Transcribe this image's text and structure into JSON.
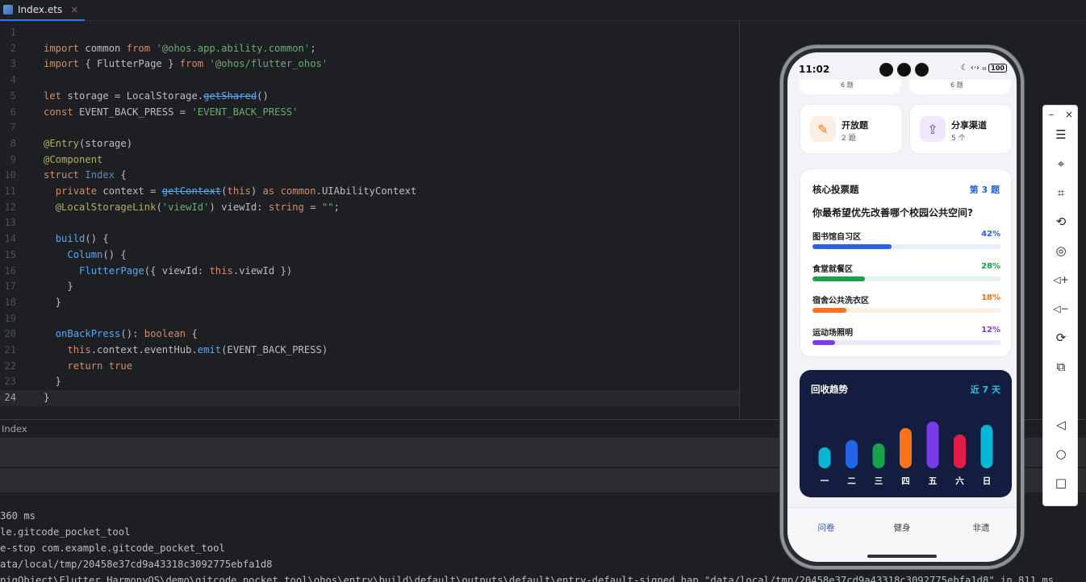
{
  "tab": {
    "name": "Index.ets",
    "close": "×"
  },
  "editor": {
    "current_line": 24,
    "lines": [
      {
        "n": "1",
        "html": ""
      },
      {
        "n": "2",
        "html": "<span class='kw'>import</span> common <span class='kw'>from</span> <span class='str'>'@ohos.app.ability.common'</span>;"
      },
      {
        "n": "3",
        "html": "<span class='kw'>import</span> { FlutterPage } <span class='kw'>from</span> <span class='str'>'@ohos/flutter_ohos'</span>"
      },
      {
        "n": "4",
        "html": ""
      },
      {
        "n": "5",
        "html": "<span class='kw'>let</span> storage = LocalStorage.<span class='dep'>getShared</span>()"
      },
      {
        "n": "6",
        "html": "<span class='kw'>const</span> EVENT_BACK_PRESS = <span class='str'>'EVENT_BACK_PRESS'</span>"
      },
      {
        "n": "7",
        "html": ""
      },
      {
        "n": "8",
        "html": "<span class='ann'>@Entry</span>(storage)"
      },
      {
        "n": "9",
        "html": "<span class='ann'>@Component</span>"
      },
      {
        "n": "10",
        "html": "<span class='kw'>struct</span> <span class='typ'>Index</span> {"
      },
      {
        "n": "11",
        "html": "  <span class='kw'>private</span> context = <span class='dep'>getContext</span>(<span class='kw'>this</span>) <span class='kw'>as</span> <span class='kw'>common</span>.UIAbilityContext"
      },
      {
        "n": "12",
        "html": "  <span class='ann'>@LocalStorageLink</span>(<span class='str'>'viewId'</span>) viewId: <span class='kw'>string</span> = <span class='str'>\"\"</span>;"
      },
      {
        "n": "13",
        "html": ""
      },
      {
        "n": "14",
        "html": "  <span class='fn'>build</span>() {"
      },
      {
        "n": "15",
        "html": "    <span class='fn'>Column</span>() {"
      },
      {
        "n": "16",
        "html": "      <span class='fn'>FlutterPage</span>({ viewId: <span class='kw'>this</span>.viewId })"
      },
      {
        "n": "17",
        "html": "    }"
      },
      {
        "n": "18",
        "html": "  }"
      },
      {
        "n": "19",
        "html": ""
      },
      {
        "n": "20",
        "html": "  <span class='fn'>onBackPress</span>(): <span class='kw'>boolean</span> {"
      },
      {
        "n": "21",
        "html": "    <span class='kw'>this</span>.context.eventHub.<span class='fn'>emit</span>(EVENT_BACK_PRESS)"
      },
      {
        "n": "22",
        "html": "    <span class='kw'>return</span> <span class='kw'>true</span>"
      },
      {
        "n": "23",
        "html": "  }"
      },
      {
        "n": "24",
        "html": "}"
      }
    ]
  },
  "bottom_panel": {
    "header": "Index",
    "log": [
      "360 ms",
      "le.gitcode_pocket_tool",
      "e-stop com.example.gitcode_pocket_tool",
      "ata/local/tmp/20458e37cd9a43318c3092775ebfa1d8",
      "pigObject\\Flutter_HarmonyOS\\demo\\gitcode_pocket_tool\\ohos\\entry\\build\\default\\outputs\\default\\entry-default-signed.hap \"data/local/tmp/20458e37cd9a43318c3092775ebfa1d8\" in 811 ms"
    ]
  },
  "phone": {
    "status": {
      "time": "11:02",
      "icons": "☾ ‹·› ᵢₗₗ",
      "battery": "100"
    },
    "partial_cards": [
      {
        "sub": "6 题"
      },
      {
        "sub": "6 题"
      }
    ],
    "mini_cards": [
      {
        "title": "开放题",
        "sub": "2 题",
        "icon": "✎",
        "icon_color": "#f97316",
        "icon_bg": "#fdeee4"
      },
      {
        "title": "分享渠道",
        "sub": "5 个",
        "icon": "⇪",
        "icon_color": "#7c3aed",
        "icon_bg": "#efe7fb"
      }
    ],
    "vote": {
      "title": "核心投票题",
      "number": "第 3 题",
      "question": "你最希望优先改善哪个校园公共空间?",
      "options": [
        {
          "label": "图书馆自习区",
          "pct_text": "42%",
          "value": 42,
          "color": "#2563eb",
          "track": "#e6edfb"
        },
        {
          "label": "食堂就餐区",
          "pct_text": "28%",
          "value": 28,
          "color": "#16a34a",
          "track": "#e4f4e9"
        },
        {
          "label": "宿舍公共洗衣区",
          "pct_text": "18%",
          "value": 18,
          "color": "#f97316",
          "track": "#fdeee4"
        },
        {
          "label": "运动场照明",
          "pct_text": "12%",
          "value": 12,
          "color": "#7c3aed",
          "track": "#efe7fb"
        }
      ]
    },
    "trend": {
      "title": "回收趋势",
      "range": "近 7 天"
    },
    "nav": [
      "问卷",
      "健身",
      "非遗"
    ]
  },
  "chart_data": {
    "type": "bar",
    "categories": [
      "一",
      "二",
      "三",
      "四",
      "五",
      "六",
      "日"
    ],
    "values": [
      26,
      35,
      31,
      50,
      58,
      42,
      54
    ],
    "colors": [
      "#06b6d4",
      "#2563eb",
      "#16a34a",
      "#f97316",
      "#7c3aed",
      "#e11d48",
      "#06b6d4"
    ],
    "title": "回收趋势",
    "xlabel": "",
    "ylabel": "",
    "grid": false
  },
  "toolbar": {
    "minimize": "–",
    "close": "×",
    "items": [
      {
        "name": "menu-icon",
        "glyph": "☰"
      },
      {
        "name": "pin-off-icon",
        "glyph": "⌖"
      },
      {
        "name": "crop-icon",
        "glyph": "⌗"
      },
      {
        "name": "rotate-icon",
        "glyph": "⟲"
      },
      {
        "name": "screenshot-icon",
        "glyph": "◎"
      },
      {
        "name": "volume-up-icon",
        "glyph": "◁+"
      },
      {
        "name": "volume-down-icon",
        "glyph": "◁−"
      },
      {
        "name": "shake-icon",
        "glyph": "⟳"
      },
      {
        "name": "multi-device-icon",
        "glyph": "⧉"
      },
      {
        "name": "back-icon",
        "glyph": "◁"
      },
      {
        "name": "home-icon",
        "glyph": "○"
      },
      {
        "name": "recents-icon",
        "glyph": "□"
      }
    ]
  }
}
